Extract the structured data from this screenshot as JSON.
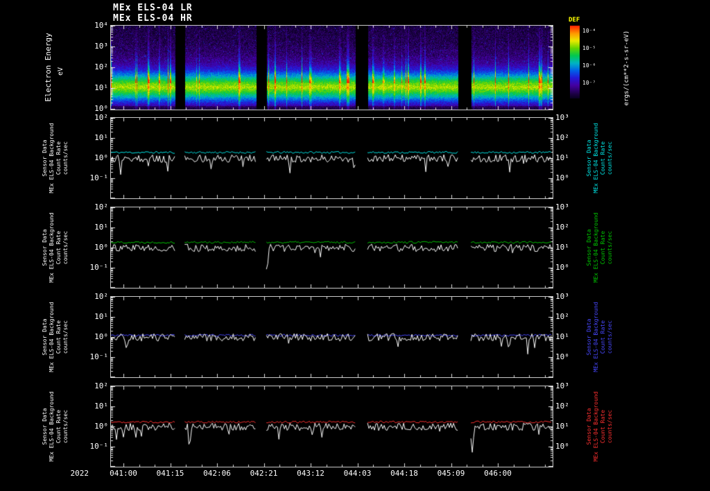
{
  "background": "#000000",
  "frame_color": "#c8c8c8",
  "titles": {
    "line1": "MEx ELS-04 LR",
    "line2": "MEx ELS-04 HR"
  },
  "spectrogram": {
    "ylabel": "Electron Energy",
    "yunit": "eV",
    "yticks": [
      "10⁴",
      "10³",
      "10²",
      "10¹",
      "10⁰"
    ],
    "colorbar": {
      "label": "DEF",
      "label_color": "#ffff00",
      "ticks": [
        "10⁻⁴",
        "10⁻⁵",
        "10⁻⁶",
        "10⁻⁷"
      ],
      "unit": "ergs/(cm**2-s-sr-eV)"
    }
  },
  "panels": [
    {
      "id": "count-rate-panel-1",
      "line_color": "#00e8e8",
      "left_ticks": [
        "10²",
        "10¹",
        "10⁰",
        "10⁻¹"
      ],
      "right_ticks": [
        "10³",
        "10²",
        "10¹",
        "10⁰"
      ],
      "left_label_lines": [
        "Sensor Data",
        "MEx ELS-04 Background",
        "Count Rate",
        "counts/sec"
      ],
      "right_label_lines": [
        "Sensor Data",
        "MEx ELS-04 Background",
        "Count Rate",
        "counts/sec"
      ]
    },
    {
      "id": "count-rate-panel-2",
      "line_color": "#00c800",
      "left_ticks": [
        "10²",
        "10¹",
        "10⁰",
        "10⁻¹"
      ],
      "right_ticks": [
        "10³",
        "10²",
        "10¹",
        "10⁰"
      ],
      "left_label_lines": [
        "Sensor Data",
        "MEx ELS-04 Background",
        "Count Rate",
        "counts/sec"
      ],
      "right_label_lines": [
        "Sensor Data",
        "MEx ELS-04 Background",
        "Count Rate",
        "counts/sec"
      ]
    },
    {
      "id": "count-rate-panel-3",
      "line_color": "#4848ff",
      "left_ticks": [
        "10²",
        "10¹",
        "10⁰",
        "10⁻¹"
      ],
      "right_ticks": [
        "10³",
        "10²",
        "10¹",
        "10⁰"
      ],
      "left_label_lines": [
        "Sensor Data",
        "MEx ELS-04 Background",
        "Count Rate",
        "counts/sec"
      ],
      "right_label_lines": [
        "Sensor Data",
        "MEx ELS-04 Background",
        "Count Rate",
        "counts/sec"
      ]
    },
    {
      "id": "count-rate-panel-4",
      "line_color": "#ff3030",
      "left_ticks": [
        "10²",
        "10¹",
        "10⁰",
        "10⁻¹"
      ],
      "right_ticks": [
        "10³",
        "10²",
        "10¹",
        "10⁰"
      ],
      "left_label_lines": [
        "Sensor Data",
        "MEx ELS-04 Background",
        "Count Rate",
        "counts/sec"
      ],
      "right_label_lines": [
        "Sensor Data",
        "MEx ELS-04 Background",
        "Count Rate",
        "counts/sec"
      ]
    }
  ],
  "xaxis": {
    "year_label": "2022",
    "tick_labels": [
      "041:00",
      "041:15",
      "042:06",
      "042:21",
      "043:12",
      "044:03",
      "044:18",
      "045:09",
      "046:00"
    ]
  },
  "chart_data": [
    {
      "type": "heatmap",
      "title": "MEx ELS-04 HR electron energy spectrogram",
      "ylabel": "Electron Energy (eV)",
      "y_log10_range": [
        0,
        4
      ],
      "x_tick_labels": [
        "041:00",
        "041:15",
        "042:06",
        "042:21",
        "043:12",
        "044:03",
        "044:18",
        "045:09",
        "046:00"
      ],
      "x_tick_format": "DDD:HH of year 2022, 15-hour spacing",
      "z_label": "DEF",
      "z_units": "ergs/(cm**2-s-sr-eV)",
      "z_log10_tick_range": [
        -4,
        -7
      ],
      "palette_stops": [
        [
          0,
          "#000010"
        ],
        [
          0.08,
          "#1a0040"
        ],
        [
          0.2,
          "#4400a0"
        ],
        [
          0.3,
          "#2418d8"
        ],
        [
          0.4,
          "#0060e8"
        ],
        [
          0.5,
          "#00b4c4"
        ],
        [
          0.6,
          "#00c850"
        ],
        [
          0.7,
          "#64d400"
        ],
        [
          0.8,
          "#eaea00"
        ],
        [
          0.9,
          "#ff9800"
        ],
        [
          1,
          "#ff2400"
        ]
      ],
      "band_profile_log10eV_intensity": [
        [
          0,
          0.13
        ],
        [
          0.3,
          0.3
        ],
        [
          0.6,
          0.5
        ],
        [
          0.85,
          0.66
        ],
        [
          1.05,
          0.76
        ],
        [
          1.3,
          0.66
        ],
        [
          1.6,
          0.47
        ],
        [
          1.9,
          0.3
        ],
        [
          2.2,
          0.2
        ],
        [
          2.6,
          0.14
        ],
        [
          3.2,
          0.1
        ],
        [
          4,
          0.08
        ]
      ],
      "features": "bright 10-30 eV flux band with frequent vertical enhancements reaching ~100 eV; sparse purple low-flux background above 100 eV",
      "data_gaps_frac": [
        [
          0.145,
          0.167
        ],
        [
          0.329,
          0.352
        ],
        [
          0.553,
          0.581
        ],
        [
          0.786,
          0.815
        ]
      ],
      "streak_probability": 0.07
    },
    {
      "type": "line",
      "panel": 1,
      "left_ylim_log10": [
        -2,
        2
      ],
      "right_ylim_log10": [
        -1,
        3
      ],
      "seed": 11,
      "deep_dips_frac": [
        0.557
      ],
      "series": [
        {
          "name": "count rate (white trace)",
          "color": "#ffffff",
          "baseline_log10": 0.0,
          "noise_log10": 0.19
        },
        {
          "name": "background count rate (cyan trace)",
          "color": "#00e8e8",
          "baseline_log10": 0.3,
          "noise_log10": 0.05
        }
      ]
    },
    {
      "type": "line",
      "panel": 2,
      "left_ylim_log10": [
        -2,
        2
      ],
      "right_ylim_log10": [
        -1,
        3
      ],
      "seed": 22,
      "deep_dips_frac": [
        0.353
      ],
      "series": [
        {
          "name": "count rate (white trace)",
          "color": "#ffffff",
          "baseline_log10": 0.0,
          "noise_log10": 0.19
        },
        {
          "name": "background count rate (green trace)",
          "color": "#00c800",
          "baseline_log10": 0.28,
          "noise_log10": 0.05
        }
      ]
    },
    {
      "type": "line",
      "panel": 3,
      "left_ylim_log10": [
        -2,
        2
      ],
      "right_ylim_log10": [
        -1,
        3
      ],
      "seed": 33,
      "deep_dips_frac": [],
      "series": [
        {
          "name": "count rate (white trace)",
          "color": "#ffffff",
          "baseline_log10": 0.0,
          "noise_log10": 0.19
        },
        {
          "name": "background count rate (blue trace)",
          "color": "#4848ff",
          "baseline_log10": 0.1,
          "noise_log10": 0.05
        }
      ]
    },
    {
      "type": "line",
      "panel": 4,
      "left_ylim_log10": [
        -2,
        2
      ],
      "right_ylim_log10": [
        -1,
        3
      ],
      "seed": 47,
      "deep_dips_frac": [
        0.818
      ],
      "series": [
        {
          "name": "count rate (white trace)",
          "color": "#ffffff",
          "baseline_log10": 0.0,
          "noise_log10": 0.19
        },
        {
          "name": "background count rate (red trace)",
          "color": "#ff3030",
          "baseline_log10": 0.24,
          "noise_log10": 0.05
        }
      ]
    }
  ]
}
